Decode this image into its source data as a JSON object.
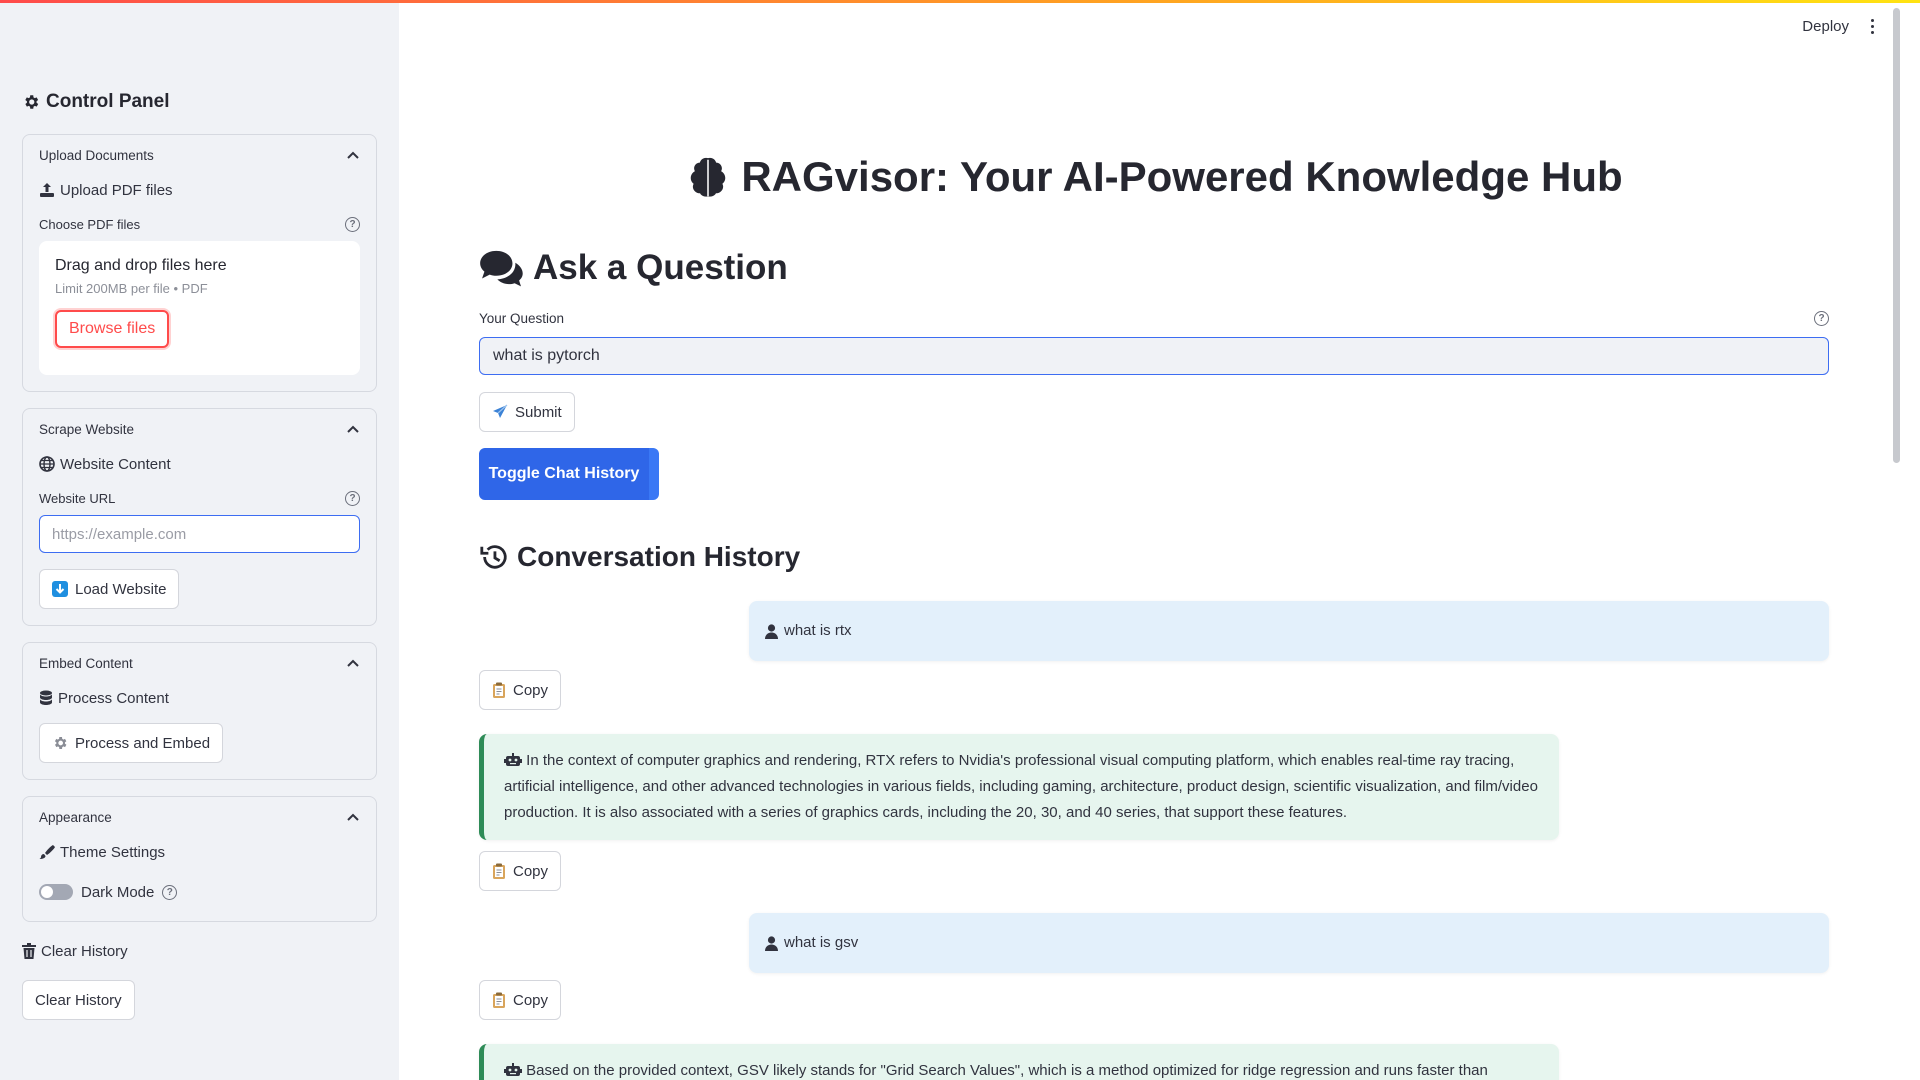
{
  "sidebar": {
    "title": "Control Panel",
    "upload": {
      "header": "Upload Documents",
      "subheader": "Upload PDF files",
      "field_label": "Choose PDF files",
      "drop_title": "Drag and drop files here",
      "drop_sub": "Limit 200MB per file • PDF",
      "browse_label": "Browse files"
    },
    "scrape": {
      "header": "Scrape Website",
      "subheader": "Website Content",
      "field_label": "Website URL",
      "placeholder": "https://example.com",
      "load_label": "Load Website"
    },
    "embed": {
      "header": "Embed Content",
      "subheader": "Process Content",
      "process_label": "Process and Embed"
    },
    "appearance": {
      "header": "Appearance",
      "subheader": "Theme Settings",
      "dark_mode_label": "Dark Mode"
    },
    "clear": {
      "subheader": "Clear History",
      "button_label": "Clear History"
    }
  },
  "header": {
    "deploy_label": "Deploy"
  },
  "main": {
    "title": "RAGvisor: Your AI-Powered Knowledge Hub",
    "ask_heading": "Ask a Question",
    "question_label": "Your Question",
    "question_value": "what is pytorch",
    "submit_label": "Submit",
    "toggle_label": "Toggle Chat History",
    "conversation_heading": "Conversation History",
    "copy_label": "Copy",
    "messages": [
      {
        "role": "user",
        "text": "what is rtx"
      },
      {
        "role": "bot",
        "text": "In the context of computer graphics and rendering, RTX refers to Nvidia's professional visual computing platform, which enables real-time ray tracing, artificial intelligence, and other advanced technologies in various fields, including gaming, architecture, product design, scientific visualization, and film/video production. It is also associated with a series of graphics cards, including the 20, 30, and 40 series, that support these features."
      },
      {
        "role": "user",
        "text": "what is gsv"
      },
      {
        "role": "bot",
        "text": "Based on the provided context, GSV likely stands for \"Grid Search Values\", which is a method optimized for ridge regression and runs faster than"
      }
    ]
  },
  "colors": {
    "primary": "#ff4b4b",
    "accent_blue": "#2f66e8",
    "user_bubble": "#e3f0fb",
    "bot_bubble": "#e6f5ee",
    "bot_border": "#2e8b57",
    "sidebar_bg": "#f0f2f6"
  },
  "icons": {
    "sidebar_title": "gear-icon",
    "upload": "upload-icon",
    "scrape": "globe-icon",
    "embed": "database-icon",
    "appearance": "paintbrush-icon",
    "clear": "trash-icon",
    "app_title": "brain-icon",
    "ask": "comments-icon",
    "conversation": "history-icon",
    "user": "user-icon",
    "bot": "robot-icon",
    "copy": "clipboard-icon",
    "submit": "airplane-icon",
    "load": "download-arrow-icon",
    "process": "gear-icon"
  }
}
